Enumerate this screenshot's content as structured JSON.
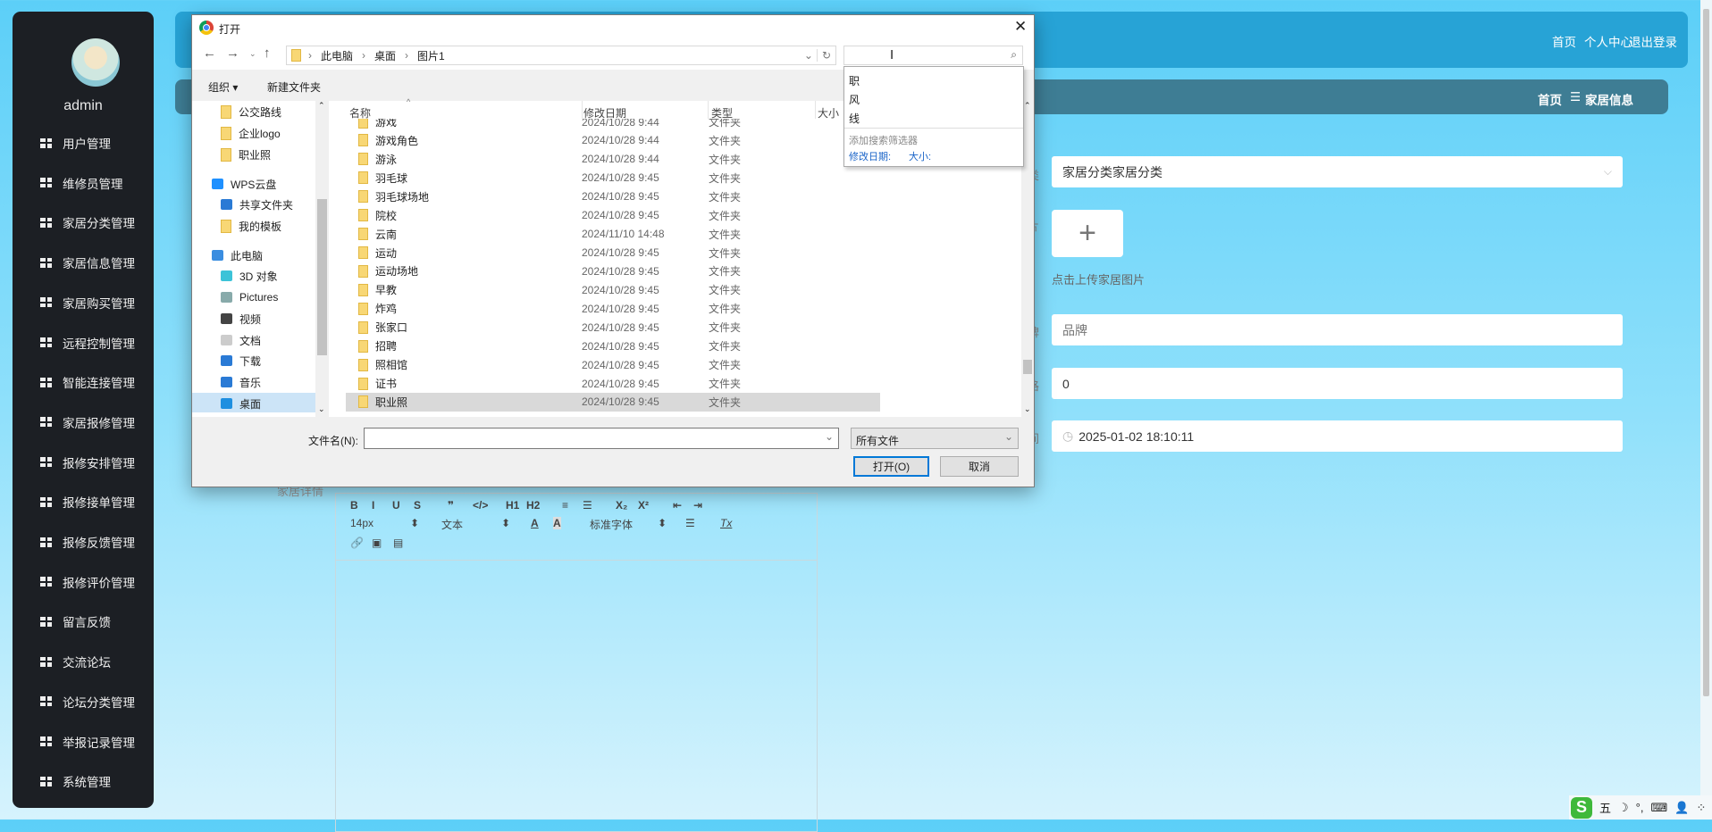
{
  "sidebar": {
    "username": "admin",
    "items": [
      {
        "label": "用户管理",
        "icon": "user-icon"
      },
      {
        "label": "维修员管理",
        "icon": "grid-icon"
      },
      {
        "label": "家居分类管理",
        "icon": "clipboard-icon"
      },
      {
        "label": "家居信息管理",
        "icon": "monitor-icon"
      },
      {
        "label": "家居购买管理",
        "icon": "grid-icon"
      },
      {
        "label": "远程控制管理",
        "icon": "chart-line-icon"
      },
      {
        "label": "智能连接管理",
        "icon": "bar-chart-icon"
      },
      {
        "label": "家居报修管理",
        "icon": "bulb-icon"
      },
      {
        "label": "报修安排管理",
        "icon": "person-icon"
      },
      {
        "label": "报修接单管理",
        "icon": "columns-icon"
      },
      {
        "label": "报修反馈管理",
        "icon": "grid-icon"
      },
      {
        "label": "报修评价管理",
        "icon": "grid-icon"
      },
      {
        "label": "留言反馈",
        "icon": "grid-icon"
      },
      {
        "label": "交流论坛",
        "icon": "grid-icon"
      },
      {
        "label": "论坛分类管理",
        "icon": "flag-icon"
      },
      {
        "label": "举报记录管理",
        "icon": "chat-icon"
      },
      {
        "label": "系统管理",
        "icon": "grid-icon"
      }
    ]
  },
  "header": {
    "links": [
      "首页",
      "个人中心",
      "退出登录"
    ]
  },
  "breadcrumb": {
    "home": "首页",
    "sep": "☰",
    "current": "家居信息"
  },
  "form": {
    "label_fragments": [
      "类",
      "片",
      "牌",
      "格",
      "间"
    ],
    "category_value": "家居分类家居分类",
    "upload_hint": "点击上传家居图片",
    "brand_placeholder": "品牌",
    "price_value": "0",
    "time_value": "2025-01-02 18:10:11",
    "detail_label": "家居详情",
    "editor": {
      "row1": [
        "B",
        "I",
        "U",
        "S",
        "❞",
        "</>",
        "H1",
        "H2",
        "≡",
        "☰",
        "X₂",
        "X²",
        "⇤",
        "⇥"
      ],
      "font_size": "14px",
      "text_style": "文本",
      "font_family": "标准字体"
    }
  },
  "dialog": {
    "title": "打开",
    "path": [
      "此电脑",
      "桌面",
      "图片1"
    ],
    "toolbar": {
      "organize": "组织 ▾",
      "new_folder": "新建文件夹"
    },
    "search_suggestions": [
      "职",
      "风",
      "线"
    ],
    "add_filter": "添加搜索筛选器",
    "filters": [
      "修改日期:",
      "大小:"
    ],
    "columns": [
      "名称",
      "修改日期",
      "类型",
      "大小"
    ],
    "nav": [
      {
        "label": "公交路线",
        "icon": "folder-icon"
      },
      {
        "label": "企业logo",
        "icon": "folder-icon"
      },
      {
        "label": "职业照",
        "icon": "folder-icon"
      },
      {
        "label": "WPS云盘",
        "icon": "cloud-icon"
      },
      {
        "label": "共享文件夹",
        "icon": "share-icon"
      },
      {
        "label": "我的模板",
        "icon": "folder-icon"
      },
      {
        "label": "此电脑",
        "icon": "computer-icon"
      },
      {
        "label": "3D 对象",
        "icon": "cube-icon"
      },
      {
        "label": "Pictures",
        "icon": "picture-icon"
      },
      {
        "label": "视频",
        "icon": "video-icon"
      },
      {
        "label": "文档",
        "icon": "document-icon"
      },
      {
        "label": "下载",
        "icon": "download-icon"
      },
      {
        "label": "音乐",
        "icon": "music-icon"
      },
      {
        "label": "桌面",
        "icon": "desktop-icon",
        "selected": true
      }
    ],
    "files": [
      {
        "name": "游戏",
        "date": "2024/10/28 9:44",
        "type": "文件夹"
      },
      {
        "name": "游戏角色",
        "date": "2024/10/28 9:44",
        "type": "文件夹"
      },
      {
        "name": "游泳",
        "date": "2024/10/28 9:44",
        "type": "文件夹"
      },
      {
        "name": "羽毛球",
        "date": "2024/10/28 9:45",
        "type": "文件夹"
      },
      {
        "name": "羽毛球场地",
        "date": "2024/10/28 9:45",
        "type": "文件夹"
      },
      {
        "name": "院校",
        "date": "2024/10/28 9:45",
        "type": "文件夹"
      },
      {
        "name": "云南",
        "date": "2024/11/10 14:48",
        "type": "文件夹"
      },
      {
        "name": "运动",
        "date": "2024/10/28 9:45",
        "type": "文件夹"
      },
      {
        "name": "运动场地",
        "date": "2024/10/28 9:45",
        "type": "文件夹"
      },
      {
        "name": "早教",
        "date": "2024/10/28 9:45",
        "type": "文件夹"
      },
      {
        "name": "炸鸡",
        "date": "2024/10/28 9:45",
        "type": "文件夹"
      },
      {
        "name": "张家口",
        "date": "2024/10/28 9:45",
        "type": "文件夹"
      },
      {
        "name": "招聘",
        "date": "2024/10/28 9:45",
        "type": "文件夹"
      },
      {
        "name": "照相馆",
        "date": "2024/10/28 9:45",
        "type": "文件夹"
      },
      {
        "name": "证书",
        "date": "2024/10/28 9:45",
        "type": "文件夹"
      },
      {
        "name": "职业照",
        "date": "2024/10/28 9:45",
        "type": "文件夹",
        "selected": true
      }
    ],
    "filename_label": "文件名(N):",
    "filename_value": "",
    "filetype": "所有文件",
    "open_button": "打开(O)",
    "cancel_button": "取消"
  },
  "ime": {
    "mode": "五",
    "items": [
      "☽",
      "°,",
      "⌨",
      "👤",
      "⁘"
    ]
  },
  "colors": {
    "sidebar": "#1c1f24",
    "header": "#27a3d6",
    "breadcrumb": "#3e7d94",
    "dialog_accent": "#0078d7"
  }
}
